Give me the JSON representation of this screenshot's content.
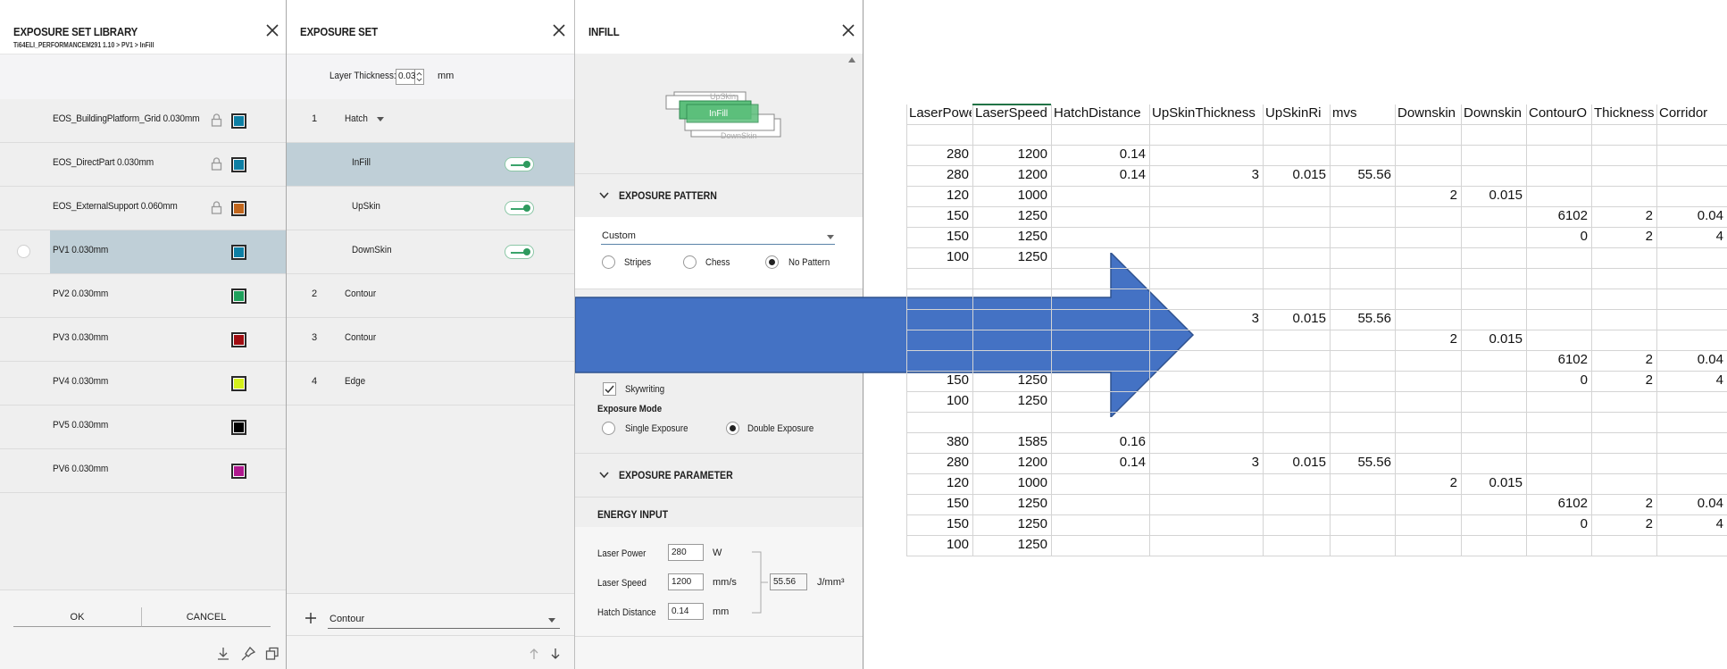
{
  "library_panel": {
    "title": "EXPOSURE SET LIBRARY",
    "breadcrumb": "Ti64ELI_PERFORMANCEM291 1.10 > PV1 > InFill",
    "items": [
      {
        "label": "EOS_BuildingPlatform_Grid 0.030mm",
        "locked": true,
        "color": "#0e7fa4"
      },
      {
        "label": "EOS_DirectPart 0.030mm",
        "locked": true,
        "color": "#0e7fa4"
      },
      {
        "label": "EOS_ExternalSupport 0.060mm",
        "locked": true,
        "color": "#c1661c"
      },
      {
        "label": "PV1 0.030mm",
        "locked": false,
        "color": "#0e7fa4",
        "selected": true
      },
      {
        "label": "PV2 0.030mm",
        "locked": false,
        "color": "#1fa05c"
      },
      {
        "label": "PV3 0.030mm",
        "locked": false,
        "color": "#a00d12"
      },
      {
        "label": "PV4 0.030mm",
        "locked": false,
        "color": "#d4ef1c"
      },
      {
        "label": "PV5 0.030mm",
        "locked": false,
        "color": "#000000"
      },
      {
        "label": "PV6 0.030mm",
        "locked": false,
        "color": "#b0198f"
      }
    ],
    "ok_label": "OK",
    "cancel_label": "CANCEL"
  },
  "exposure_set_panel": {
    "title": "EXPOSURE SET",
    "layer_thickness_label": "Layer Thickness:",
    "layer_thickness_value": "0.03",
    "layer_thickness_unit": "mm",
    "rows": [
      {
        "num": "1",
        "label": "Hatch",
        "type": "group"
      },
      {
        "num": "",
        "label": "InFill",
        "type": "sub",
        "toggle": true,
        "selected": true
      },
      {
        "num": "",
        "label": "UpSkin",
        "type": "sub",
        "toggle": true
      },
      {
        "num": "",
        "label": "DownSkin",
        "type": "sub",
        "toggle": true
      },
      {
        "num": "2",
        "label": "Contour",
        "type": "group"
      },
      {
        "num": "3",
        "label": "Contour",
        "type": "group"
      },
      {
        "num": "4",
        "label": "Edge",
        "type": "group"
      }
    ],
    "add_select_value": "Contour"
  },
  "infill_panel": {
    "title": "INFILL",
    "diagram_labels": {
      "upskin": "UpSkin",
      "infill": "InFill",
      "downskin": "DownSkin"
    },
    "exposure_pattern_header": "EXPOSURE PATTERN",
    "pattern_select_value": "Custom",
    "pattern_options": [
      "Stripes",
      "Chess",
      "No Pattern"
    ],
    "pattern_selected": "No Pattern",
    "skywriting_label": "Skywriting",
    "skywriting_checked": true,
    "exposure_mode_label": "Exposure Mode",
    "exposure_mode_options": [
      "Single Exposure",
      "Double Exposure"
    ],
    "exposure_mode_selected": "Double Exposure",
    "exposure_parameter_header": "EXPOSURE PARAMETER",
    "energy_input_header": "ENERGY INPUT",
    "laser_power_label": "Laser Power",
    "laser_power_value": "280",
    "laser_power_unit": "W",
    "laser_speed_label": "Laser Speed",
    "laser_speed_value": "1200",
    "laser_speed_unit": "mm/s",
    "hatch_distance_label": "Hatch Distance",
    "hatch_distance_value": "0.14",
    "hatch_distance_unit": "mm",
    "energy_value": "55.56",
    "energy_unit": "J/mm³"
  },
  "arrow_color": "#4472c4",
  "spreadsheet": {
    "headers": [
      "LaserPower",
      "LaserSpeed",
      "HatchDistance",
      "UpSkinThickness",
      "UpSkinRi",
      "mvs",
      "Downskin",
      "Downskin",
      "ContourO",
      "Thickness",
      "Corridor"
    ],
    "rows": [
      [
        "",
        "",
        "",
        "",
        "",
        "",
        "",
        "",
        "",
        "",
        ""
      ],
      [
        "280",
        "1200",
        "0.14",
        "",
        "",
        "",
        "",
        "",
        "",
        "",
        ""
      ],
      [
        "280",
        "1200",
        "0.14",
        "3",
        "0.015",
        "55.56",
        "",
        "",
        "",
        "",
        ""
      ],
      [
        "120",
        "1000",
        "",
        "",
        "",
        "",
        "2",
        "0.015",
        "",
        "",
        ""
      ],
      [
        "150",
        "1250",
        "",
        "",
        "",
        "",
        "",
        "",
        "6102",
        "2",
        "0.04"
      ],
      [
        "150",
        "1250",
        "",
        "",
        "",
        "",
        "",
        "",
        "0",
        "2",
        "4"
      ],
      [
        "100",
        "1250",
        "",
        "",
        "",
        "",
        "",
        "",
        "",
        "",
        ""
      ],
      [
        "",
        "",
        "",
        "",
        "",
        "",
        "",
        "",
        "",
        "",
        ""
      ],
      [
        "",
        "",
        "",
        "",
        "",
        "",
        "",
        "",
        "",
        "",
        ""
      ],
      [
        "",
        "",
        "",
        "3",
        "0.015",
        "55.56",
        "",
        "",
        "",
        "",
        ""
      ],
      [
        "",
        "",
        "",
        "",
        "",
        "",
        "2",
        "0.015",
        "",
        "",
        ""
      ],
      [
        "",
        "",
        "",
        "",
        "",
        "",
        "",
        "",
        "6102",
        "2",
        "0.04"
      ],
      [
        "150",
        "1250",
        "",
        "",
        "",
        "",
        "",
        "",
        "0",
        "2",
        "4"
      ],
      [
        "100",
        "1250",
        "",
        "",
        "",
        "",
        "",
        "",
        "",
        "",
        ""
      ],
      [
        "",
        "",
        "",
        "",
        "",
        "",
        "",
        "",
        "",
        "",
        ""
      ],
      [
        "380",
        "1585",
        "0.16",
        "",
        "",
        "",
        "",
        "",
        "",
        "",
        ""
      ],
      [
        "280",
        "1200",
        "0.14",
        "3",
        "0.015",
        "55.56",
        "",
        "",
        "",
        "",
        ""
      ],
      [
        "120",
        "1000",
        "",
        "",
        "",
        "",
        "2",
        "0.015",
        "",
        "",
        ""
      ],
      [
        "150",
        "1250",
        "",
        "",
        "",
        "",
        "",
        "",
        "6102",
        "2",
        "0.04"
      ],
      [
        "150",
        "1250",
        "",
        "",
        "",
        "",
        "",
        "",
        "0",
        "2",
        "4"
      ],
      [
        "100",
        "1250",
        "",
        "",
        "",
        "",
        "",
        "",
        "",
        "",
        ""
      ]
    ]
  }
}
